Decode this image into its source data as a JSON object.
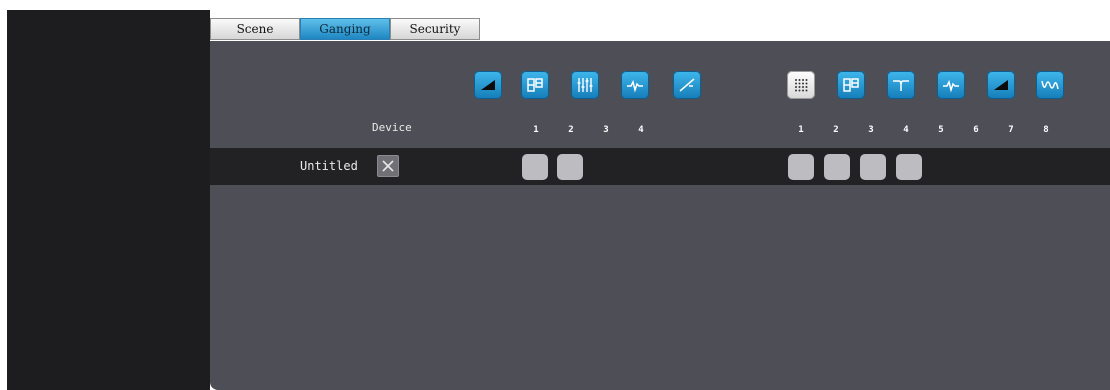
{
  "tabs": [
    {
      "label": "Scene",
      "active": false
    },
    {
      "label": "Ganging",
      "active": true
    },
    {
      "label": "Security",
      "active": false
    }
  ],
  "grid": {
    "header_label": "Device",
    "group1_icons": [
      "gain-ramp-icon",
      "router-icon",
      "mixer-faders-icon",
      "waveform-icon",
      "slope-curve-icon"
    ],
    "group2_icons": [
      "matrix-grid-icon",
      "router-icon",
      "crossover-icon",
      "waveform-icon",
      "gain-ramp-icon",
      "filter-wave-icon"
    ],
    "group1_columns": [
      "1",
      "2",
      "3",
      "4"
    ],
    "group2_columns": [
      "1",
      "2",
      "3",
      "4",
      "5",
      "6",
      "7",
      "8"
    ],
    "rows": [
      {
        "name": "Untitled",
        "group1_checked": [
          true,
          true,
          false,
          false
        ],
        "group2_checked": [
          true,
          true,
          true,
          true,
          false,
          false,
          false,
          false
        ]
      }
    ]
  },
  "colors": {
    "accent": "#1f86c2",
    "panel": "#4e4e56",
    "row": "#222225",
    "cell": "#bdbdc1",
    "sidebar": "#1d1d1f"
  }
}
